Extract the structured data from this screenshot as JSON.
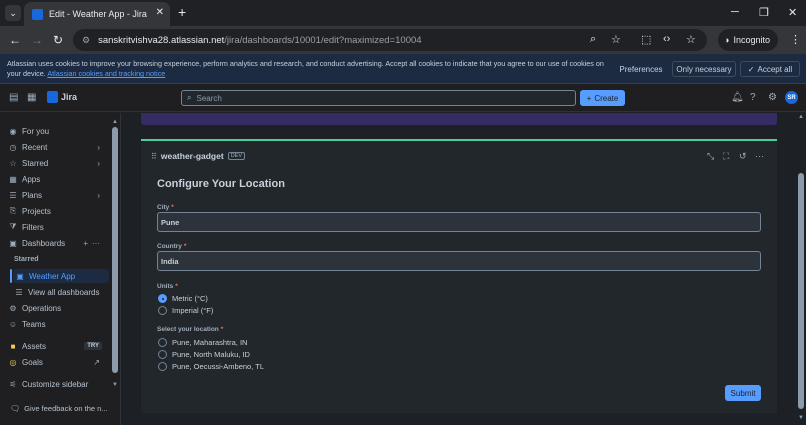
{
  "browser": {
    "tab_title": "Edit - Weather App - Jira",
    "url_host": "sanskritvishva28.atlassian.net",
    "url_path": "/jira/dashboards/10001/edit?maximized=10004",
    "incognito_label": "Incognito"
  },
  "cookie_banner": {
    "text": "Atlassian uses cookies to improve your browsing experience, perform analytics and research, and conduct advertising. Accept all cookies to indicate that you agree to our use of cookies on your device.",
    "link": "Atlassian cookies and tracking notice",
    "preferences": "Preferences",
    "only_necessary": "Only necessary",
    "accept_all": "Accept all"
  },
  "topbar": {
    "brand": "Jira",
    "search_placeholder": "Search",
    "create_label": "Create",
    "avatar_initials": "SR"
  },
  "sidebar": {
    "items": [
      {
        "label": "For you"
      },
      {
        "label": "Recent"
      },
      {
        "label": "Starred"
      },
      {
        "label": "Apps"
      },
      {
        "label": "Plans"
      },
      {
        "label": "Projects"
      },
      {
        "label": "Filters"
      },
      {
        "label": "Dashboards"
      }
    ],
    "section_starred": "Starred",
    "active_item": "Weather App",
    "view_all": "View all dashboards",
    "more_items": [
      {
        "label": "Operations"
      },
      {
        "label": "Teams"
      },
      {
        "label": "Assets",
        "badge": "TRY"
      },
      {
        "label": "Goals"
      },
      {
        "label": "Customize sidebar"
      }
    ],
    "feedback": "Give feedback on the n..."
  },
  "gadget": {
    "name": "weather-gadget",
    "badge": "DEV",
    "title": "Configure Your Location",
    "city_label": "City",
    "city_value": "Pune",
    "country_label": "Country",
    "country_value": "India",
    "units_label": "Units",
    "units": [
      {
        "label": "Metric (°C)",
        "selected": true
      },
      {
        "label": "Imperial (°F)",
        "selected": false
      }
    ],
    "location_label": "Select your location",
    "locations": [
      {
        "label": "Pune, Maharashtra, IN"
      },
      {
        "label": "Pune, North Maluku, ID"
      },
      {
        "label": "Pune, Oecussi-Ambeno, TL"
      }
    ],
    "submit_label": "Submit",
    "required_mark": "*"
  },
  "colors": {
    "accent": "#579dff",
    "success_border": "#4bce97",
    "background": "#1d2125"
  }
}
